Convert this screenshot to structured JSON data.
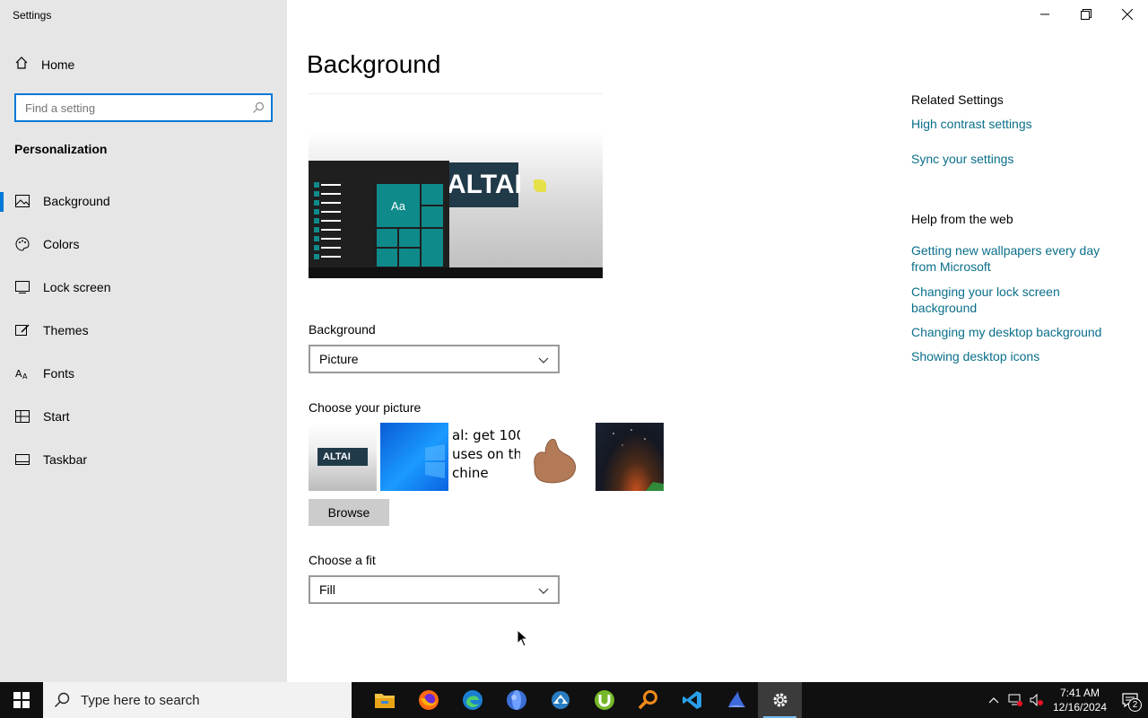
{
  "window": {
    "title": "Settings",
    "controls": [
      "minimize",
      "restore",
      "close"
    ]
  },
  "sidebar": {
    "home_label": "Home",
    "search_placeholder": "Find a setting",
    "section_title": "Personalization",
    "items": [
      {
        "label": "Background",
        "icon": "picture-icon",
        "active": true
      },
      {
        "label": "Colors",
        "icon": "palette-icon",
        "active": false
      },
      {
        "label": "Lock screen",
        "icon": "lock-screen-icon",
        "active": false
      },
      {
        "label": "Themes",
        "icon": "brush-icon",
        "active": false
      },
      {
        "label": "Fonts",
        "icon": "font-icon",
        "active": false
      },
      {
        "label": "Start",
        "icon": "start-tiles-icon",
        "active": false
      },
      {
        "label": "Taskbar",
        "icon": "taskbar-icon",
        "active": false
      }
    ]
  },
  "main": {
    "title": "Background",
    "preview": {
      "tile_label": "Aa",
      "logo_text": "ALTAI"
    },
    "background_label": "Background",
    "background_value": "Picture",
    "choose_picture_label": "Choose your picture",
    "pictures": [
      {
        "name": "altai-logo",
        "text": "ALTAI"
      },
      {
        "name": "windows-blue",
        "text": ""
      },
      {
        "name": "text-image",
        "lines": [
          "al: get 100",
          "uses on th",
          "chine"
        ]
      },
      {
        "name": "hand-image",
        "text": ""
      },
      {
        "name": "night-sky",
        "text": ""
      }
    ],
    "browse_label": "Browse",
    "fit_label": "Choose a fit",
    "fit_value": "Fill"
  },
  "related": {
    "related_heading": "Related Settings",
    "related_links": [
      "High contrast settings",
      "Sync your settings"
    ],
    "help_heading": "Help from the web",
    "help_links": [
      "Getting new wallpapers every day from Microsoft",
      "Changing your lock screen background",
      "Changing my desktop background",
      "Showing desktop icons"
    ]
  },
  "taskbar": {
    "search_placeholder": "Type here to search",
    "apps": [
      "file-explorer-icon",
      "firefox-icon",
      "edge-icon",
      "globe-icon",
      "network-app-icon",
      "utorrent-icon",
      "search-magnifier-icon",
      "vscode-icon",
      "shark-icon",
      "settings-gear-icon"
    ],
    "time": "7:41 AM",
    "date": "12/16/2024",
    "notification_count": "2"
  },
  "colors": {
    "accent": "#0078d7",
    "link": "#0a6f8a",
    "sidebar_bg": "#e6e6e6",
    "taskbar_bg": "#101010"
  }
}
